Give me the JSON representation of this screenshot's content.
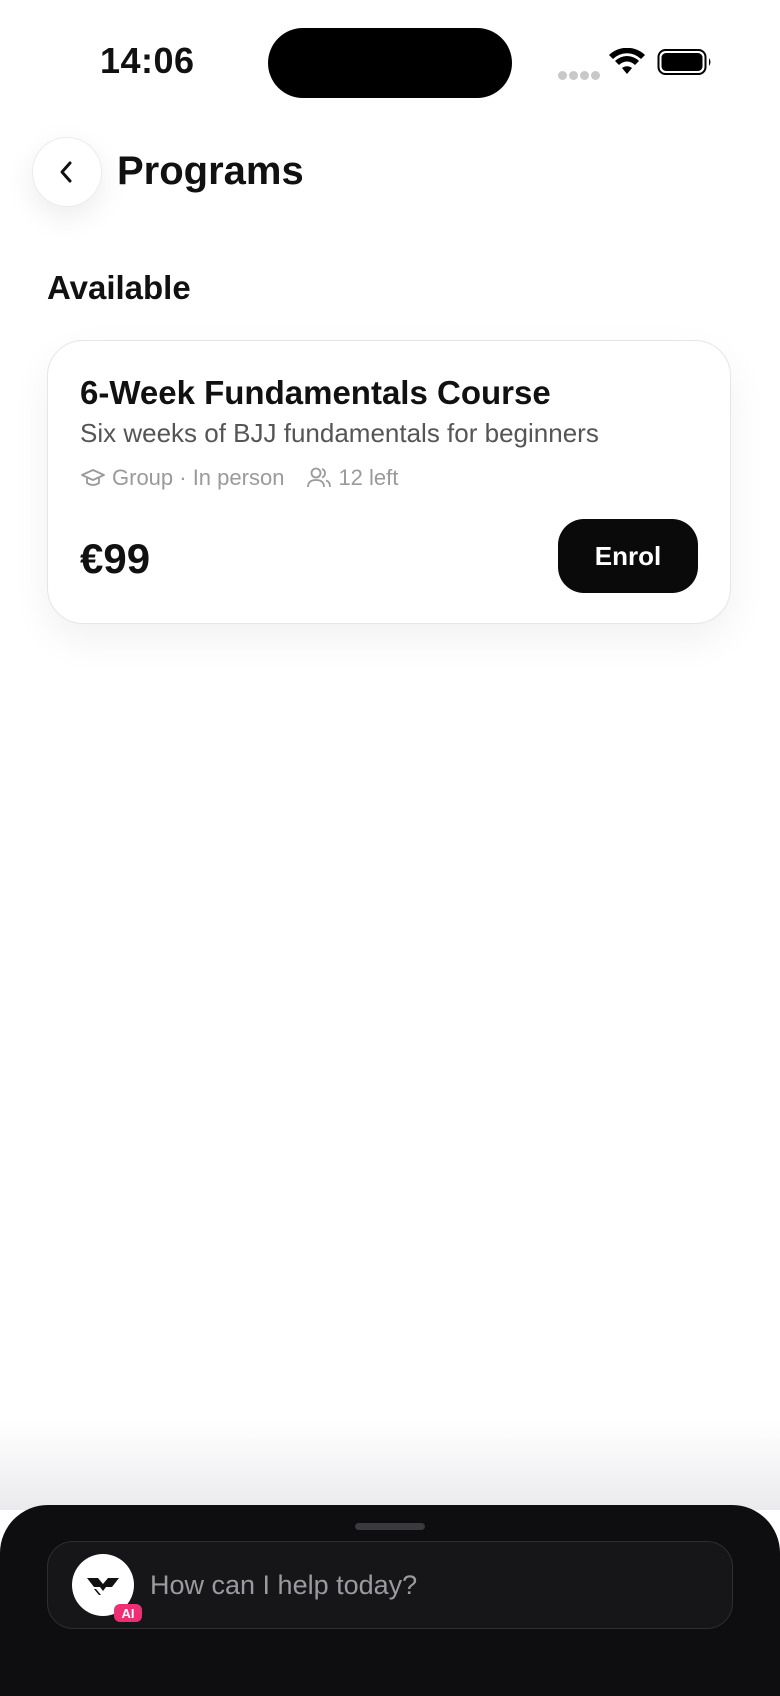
{
  "status_bar": {
    "time": "14:06"
  },
  "header": {
    "title": "Programs"
  },
  "section": {
    "title": "Available"
  },
  "programs": [
    {
      "title": "6-Week Fundamentals Course",
      "description": "Six weeks of BJJ fundamentals for beginners",
      "format": "Group · In person",
      "spots": "12 left",
      "price": "€99",
      "action_label": "Enrol"
    }
  ],
  "assistant": {
    "placeholder": "How can I help today?",
    "badge": "AI"
  },
  "colors": {
    "background": "#ffffff",
    "primary_button": "#0a0a0a",
    "assistant_sheet": "#0e0e10",
    "ai_badge": "#ef2f74"
  }
}
